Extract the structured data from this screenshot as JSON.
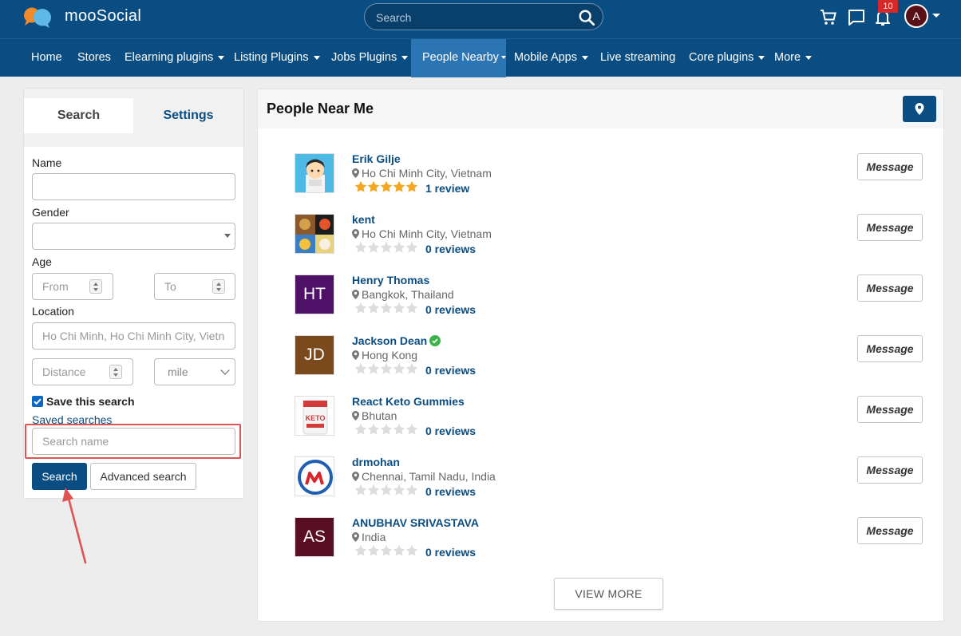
{
  "header": {
    "app_name": "mooSocial",
    "search_placeholder": "Search",
    "notification_count": "10",
    "avatar_initial": "A"
  },
  "nav": {
    "items": [
      {
        "label": "Home",
        "has_dropdown": false
      },
      {
        "label": "Stores",
        "has_dropdown": false
      },
      {
        "label": "Elearning plugins",
        "has_dropdown": true
      },
      {
        "label": "Listing Plugins",
        "has_dropdown": true
      },
      {
        "label": "Jobs Plugins",
        "has_dropdown": true
      },
      {
        "label": "People Nearby",
        "has_dropdown": true,
        "active": true
      },
      {
        "label": "Mobile Apps",
        "has_dropdown": true
      },
      {
        "label": "Live streaming",
        "has_dropdown": false
      },
      {
        "label": "Core plugins",
        "has_dropdown": true
      },
      {
        "label": "More",
        "has_dropdown": true
      }
    ]
  },
  "sidebar": {
    "tabs": {
      "search": "Search",
      "settings": "Settings"
    },
    "labels": {
      "name": "Name",
      "gender": "Gender",
      "age": "Age",
      "location": "Location",
      "save_this_search": "Save this search",
      "saved_searches": "Saved searches"
    },
    "placeholders": {
      "age_from": "From",
      "age_to": "To",
      "location": "Ho Chi Minh, Ho Chi Minh City, Vietnam",
      "distance": "Distance",
      "search_name": "Search name"
    },
    "distance_unit": "mile",
    "save_checked": true,
    "buttons": {
      "search": "Search",
      "advanced": "Advanced search"
    }
  },
  "main": {
    "title": "People Near Me",
    "message_label": "Message",
    "view_more": "VIEW MORE",
    "people": [
      {
        "name": "Erik Gilje",
        "location": "Ho Chi Minh City, Vietnam",
        "rating": 5,
        "reviews": "1 review",
        "avatar": "image"
      },
      {
        "name": "kent",
        "location": "Ho Chi Minh City, Vietnam",
        "rating": 0,
        "reviews": "0 reviews",
        "avatar": "image"
      },
      {
        "name": "Henry Thomas",
        "location": "Bangkok, Thailand",
        "rating": 0,
        "reviews": "0 reviews",
        "avatar": "HT"
      },
      {
        "name": "Jackson Dean",
        "location": "Hong Kong",
        "rating": 0,
        "reviews": "0 reviews",
        "avatar": "JD",
        "verified": true
      },
      {
        "name": "React Keto Gummies",
        "location": "Bhutan",
        "rating": 0,
        "reviews": "0 reviews",
        "avatar": "image"
      },
      {
        "name": "drmohan",
        "location": "Chennai, Tamil Nadu, India",
        "rating": 0,
        "reviews": "0 reviews",
        "avatar": "image"
      },
      {
        "name": "ANUBHAV SRIVASTAVA",
        "location": "India",
        "rating": 0,
        "reviews": "0 reviews",
        "avatar": "AS"
      }
    ]
  },
  "colors": {
    "brand": "#0a4d82",
    "nav_active": "#2b75b4",
    "star_filled": "#f5a623",
    "star_empty": "#dddddd",
    "annotation": "#e05353",
    "avatar_ht": "#4f1068",
    "avatar_jd": "#7a4a1c",
    "avatar_as": "#5a0e24"
  }
}
